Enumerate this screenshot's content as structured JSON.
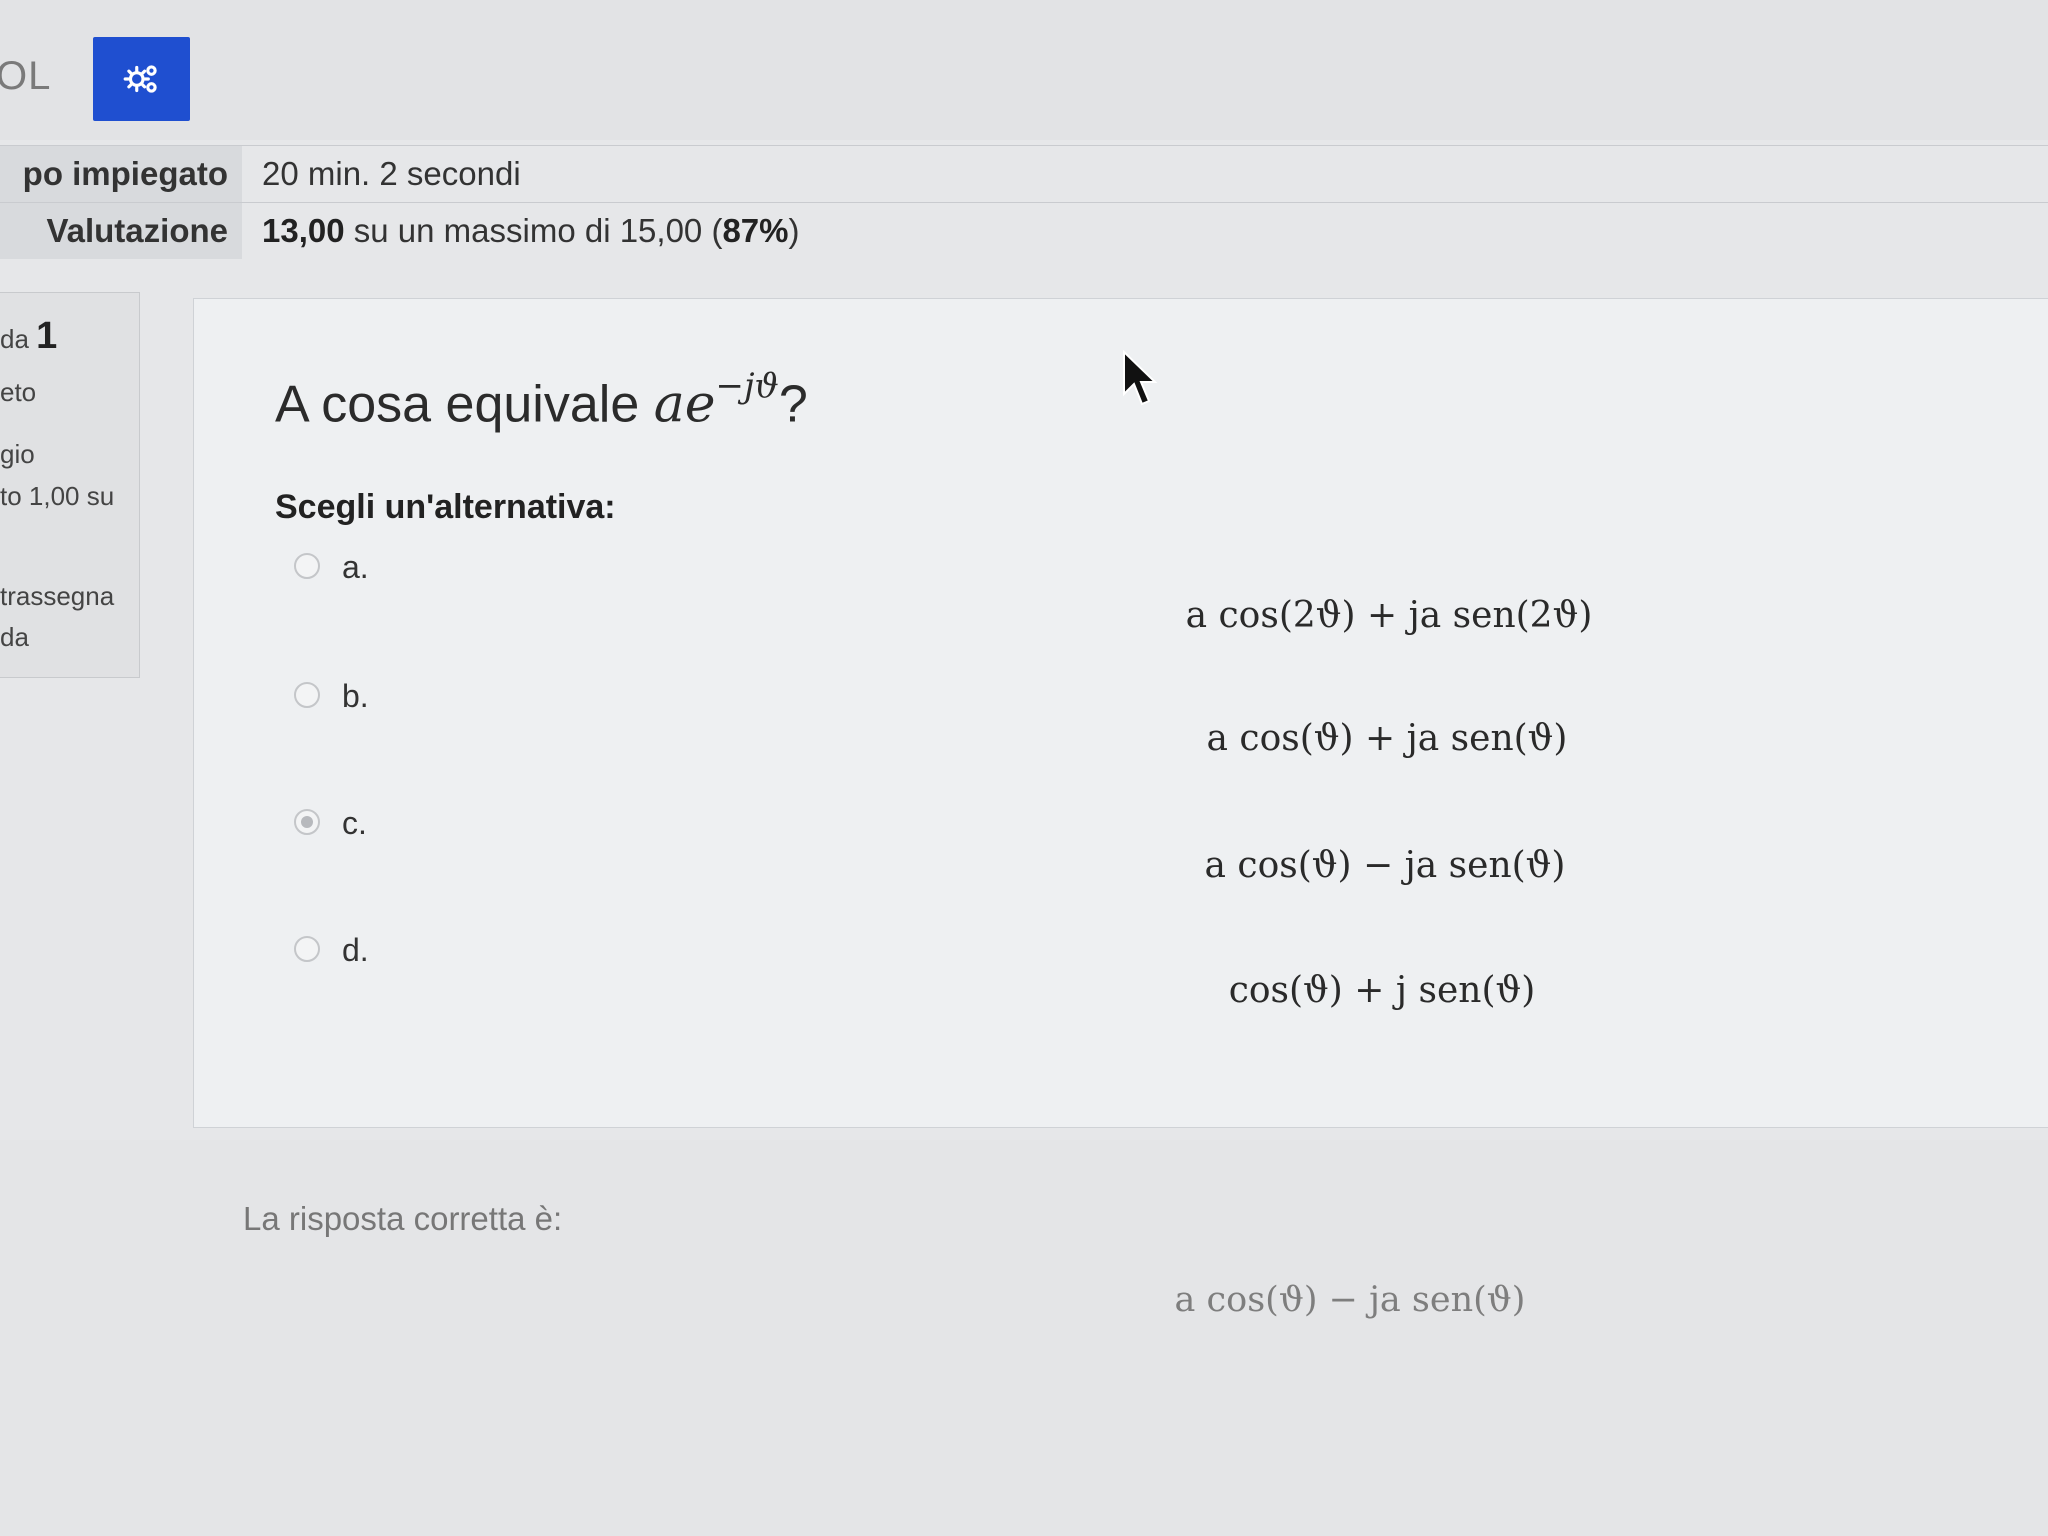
{
  "header": {
    "brand_fragment": "OL",
    "settings_icon": "gears-icon",
    "accent_color": "#1f4fd0"
  },
  "summary": {
    "time_label": "po impiegato",
    "time_value": "20 min. 2 secondi",
    "grade_label": "Valutazione",
    "grade_score": "13,00",
    "grade_middle": " su un massimo di 15,00 (",
    "grade_percent": "87%",
    "grade_close": ")"
  },
  "info": {
    "question_prefix": "da",
    "question_number": "1",
    "status": "eto",
    "grade_heading": "gio",
    "grade_text": "to 1,00 su",
    "flag_line1": "trassegna",
    "flag_line2": "da"
  },
  "question": {
    "text": "A cosa equivale ",
    "math_base": "ae",
    "math_exp": "−jϑ",
    "text_end": "?",
    "prompt": "Scegli un'alternativa:"
  },
  "options": [
    {
      "letter": "a.",
      "formula": "a cos(2ϑ) + ja sen(2ϑ)",
      "selected": false
    },
    {
      "letter": "b.",
      "formula": "a cos(ϑ) + ja sen(ϑ)",
      "selected": false
    },
    {
      "letter": "c.",
      "formula": "a cos(ϑ) − ja sen(ϑ)",
      "selected": true
    },
    {
      "letter": "d.",
      "formula": "cos(ϑ) + j sen(ϑ)",
      "selected": false
    }
  ],
  "feedback": {
    "label": "La risposta corretta è:",
    "formula": "a cos(ϑ) − ja sen(ϑ)"
  }
}
